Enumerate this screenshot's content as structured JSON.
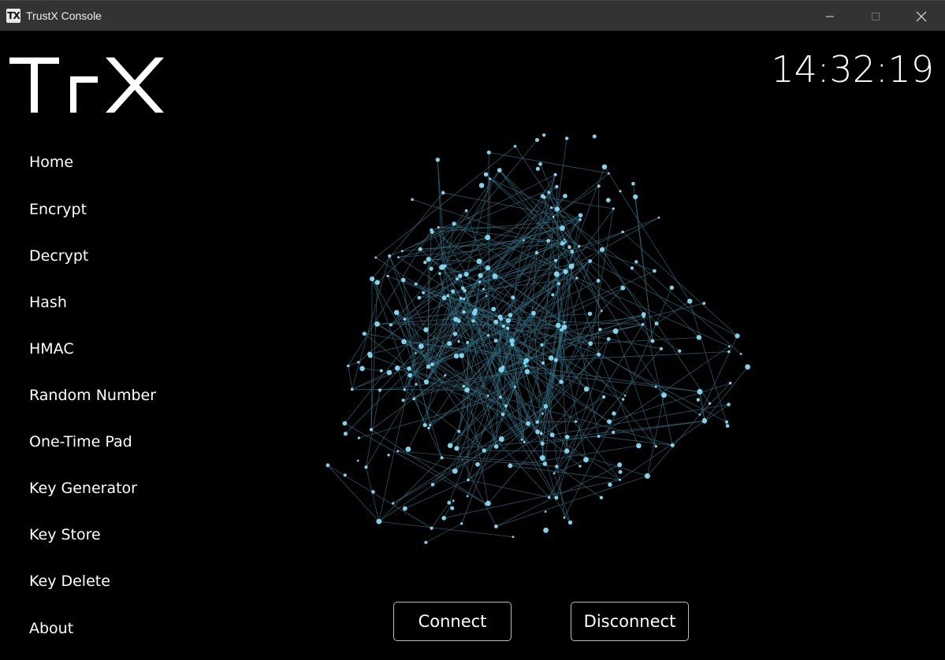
{
  "window": {
    "title": "TrustX Console",
    "icon_text": "TX",
    "icon": "trustx-app-icon",
    "controls": {
      "minimize": "minimize-icon",
      "maximize": "maximize-icon",
      "close": "close-icon"
    }
  },
  "logo": {
    "text": "TrX"
  },
  "clock": {
    "time": "14:32:19"
  },
  "nav": {
    "items": [
      {
        "label": "Home"
      },
      {
        "label": "Encrypt"
      },
      {
        "label": "Decrypt"
      },
      {
        "label": "Hash"
      },
      {
        "label": "HMAC"
      },
      {
        "label": "Random Number"
      },
      {
        "label": "One-Time Pad"
      },
      {
        "label": "Key Generator"
      },
      {
        "label": "Key Store"
      },
      {
        "label": "Key Delete"
      },
      {
        "label": "About"
      }
    ]
  },
  "actions": {
    "connect_label": "Connect",
    "disconnect_label": "Disconnect"
  },
  "colors": {
    "background": "#000000",
    "titlebar": "#333333",
    "node": "#7fd3ec",
    "edge": "#2f6c7e",
    "text": "#ffffff"
  }
}
